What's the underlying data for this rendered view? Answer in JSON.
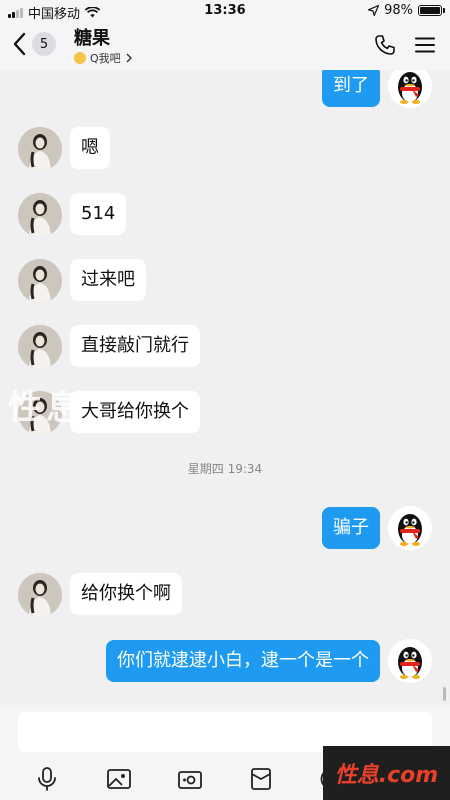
{
  "status_bar": {
    "carrier": "中国移动",
    "time": "13:36",
    "battery": "98%",
    "battery_level": 0.98
  },
  "header": {
    "unread_count": "5",
    "title": "糖果",
    "subtitle": "Q我吧"
  },
  "messages": [
    {
      "side": "right",
      "text": "到了"
    },
    {
      "side": "left",
      "text": "嗯"
    },
    {
      "side": "left",
      "text": "514"
    },
    {
      "side": "left",
      "text": "过来吧"
    },
    {
      "side": "left",
      "text": "直接敲门就行"
    },
    {
      "side": "left",
      "text": "大哥给你换个"
    },
    {
      "side": "right",
      "text": "骗子"
    },
    {
      "side": "left",
      "text": "给你换个啊"
    },
    {
      "side": "right",
      "text": "你们就逮逮小白，逮一个是一个"
    }
  ],
  "time_divider": "星期四 19:34",
  "input": {
    "value": "",
    "placeholder": ""
  },
  "toolbar_icons": [
    "microphone-icon",
    "image-icon",
    "camera-icon",
    "red-packet-icon",
    "emoji-icon"
  ],
  "watermark": {
    "logo_text": "性息.com",
    "overlay_text": "性息"
  },
  "colors": {
    "accent": "#1e9bf0",
    "background": "#f0f0f2",
    "bubble_left": "#ffffff"
  }
}
